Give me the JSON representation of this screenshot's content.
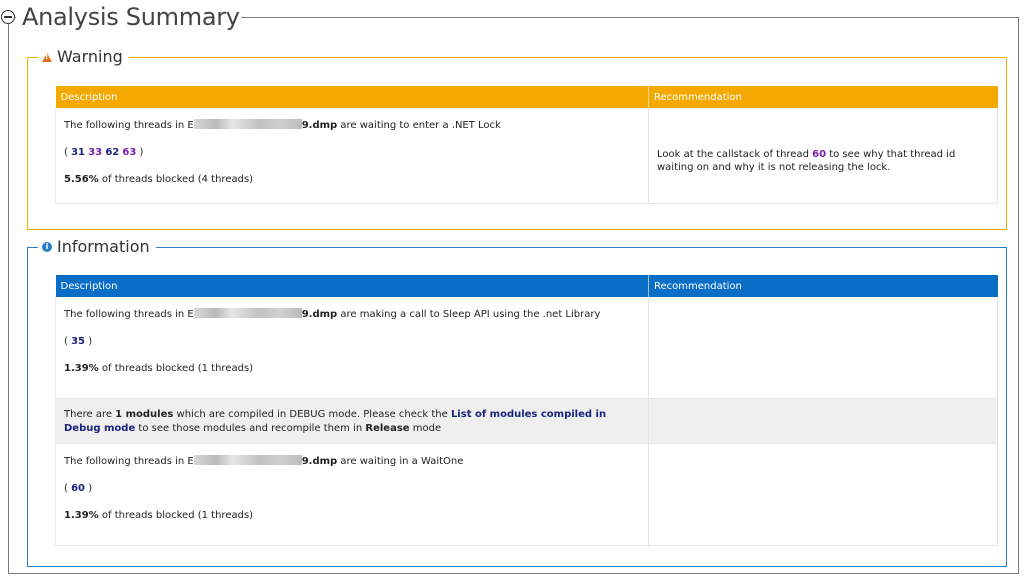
{
  "main": {
    "title": "Analysis Summary"
  },
  "warning": {
    "legend": "Warning",
    "headers": {
      "description": "Description",
      "recommendation": "Recommendation"
    },
    "row": {
      "prefix": "The following threads in ",
      "blurred_start": "E",
      "file_end": "9.dmp",
      "suffix": " are waiting to enter a .NET Lock",
      "thread_open": "( ",
      "threads": [
        "31",
        "33",
        "62",
        "63"
      ],
      "thread_close": " )",
      "pct": "5.56%",
      "pct_text": " of threads blocked (4 threads)",
      "rec_prefix": "Look at the callstack of thread ",
      "rec_thread": "60",
      "rec_suffix": " to see why that thread id waiting on and why it is not releasing the lock."
    }
  },
  "information": {
    "legend": "Information",
    "headers": {
      "description": "Description",
      "recommendation": "Recommendation"
    },
    "rows": [
      {
        "prefix": "The following threads in ",
        "blurred_start": "E",
        "file_end": "9.dmp",
        "suffix": " are making a call to Sleep API using the .net Library",
        "thread_open": "( ",
        "thread": "35",
        "thread_close": " )",
        "pct": "1.39%",
        "pct_text": " of threads blocked (1 threads)"
      },
      {
        "t1": "There are ",
        "bold1": "1 modules",
        "t2": " which are compiled in DEBUG mode. Please check the ",
        "link": "List of modules compiled in Debug mode",
        "t3": " to see those modules and recompile them in ",
        "bold2": "Release",
        "t4": " mode"
      },
      {
        "prefix": "The following threads in ",
        "blurred_start": "E",
        "file_end": "9.dmp",
        "suffix": " are waiting in a WaitOne",
        "thread_open": "( ",
        "thread": "60",
        "thread_close": " )",
        "pct": "1.39%",
        "pct_text": " of threads blocked (1 threads)"
      }
    ]
  }
}
